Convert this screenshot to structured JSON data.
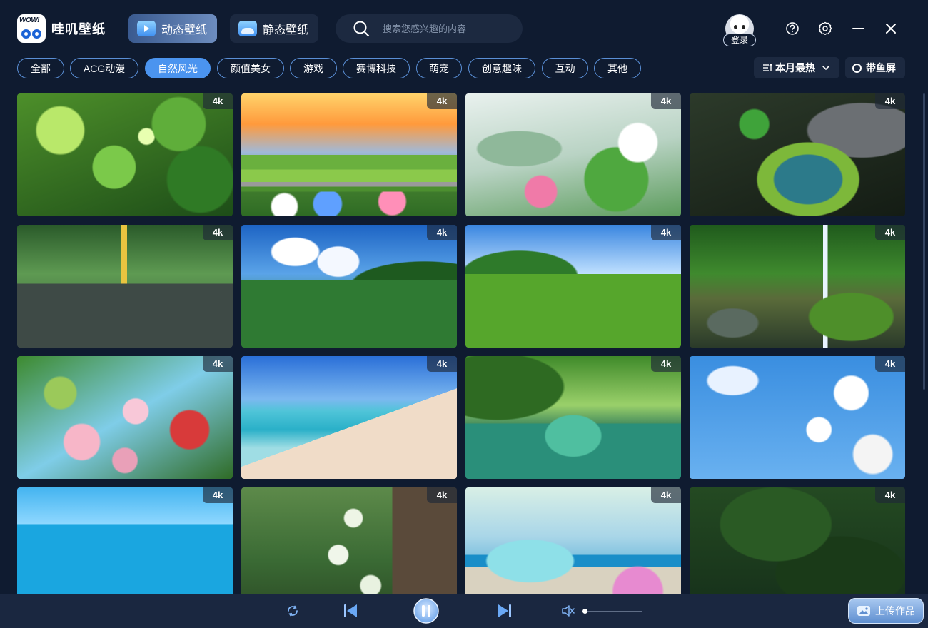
{
  "app": {
    "logo_badge_text": "WOW!",
    "name": "哇叽壁纸"
  },
  "header": {
    "tabs": [
      {
        "label": "动态壁纸",
        "active": true,
        "icon": "tv-icon"
      },
      {
        "label": "静态壁纸",
        "active": false,
        "icon": "picture-icon"
      }
    ],
    "search": {
      "placeholder": "搜索您感兴趣的内容",
      "value": ""
    },
    "login_label": "登录",
    "window_controls": [
      "help-icon",
      "settings-icon",
      "minimize-icon",
      "close-icon"
    ]
  },
  "categories": [
    {
      "label": "全部",
      "active": false
    },
    {
      "label": "ACG动漫",
      "active": false
    },
    {
      "label": "自然风光",
      "active": true
    },
    {
      "label": "颜值美女",
      "active": false
    },
    {
      "label": "游戏",
      "active": false
    },
    {
      "label": "赛博科技",
      "active": false
    },
    {
      "label": "萌宠",
      "active": false
    },
    {
      "label": "创意趣味",
      "active": false
    },
    {
      "label": "互动",
      "active": false
    },
    {
      "label": "其他",
      "active": false
    }
  ],
  "sort": {
    "label": "本月最热"
  },
  "fish_mode": {
    "label": "带鱼屏",
    "checked": false
  },
  "wallpapers": [
    {
      "badge": "4k"
    },
    {
      "badge": "4k"
    },
    {
      "badge": "4k"
    },
    {
      "badge": "4k"
    },
    {
      "badge": "4k"
    },
    {
      "badge": "4k"
    },
    {
      "badge": "4k"
    },
    {
      "badge": "4k"
    },
    {
      "badge": "4k"
    },
    {
      "badge": "4k"
    },
    {
      "badge": "4k"
    },
    {
      "badge": "4k"
    },
    {
      "badge": "4k"
    },
    {
      "badge": "4k"
    },
    {
      "badge": "4k"
    },
    {
      "badge": "4k"
    }
  ],
  "player": {
    "volume": 0,
    "muted": true,
    "upload_label": "上传作品"
  },
  "colors": {
    "background": "#0f1b30",
    "accent": "#4b94ef",
    "panel": "#1c2940"
  }
}
